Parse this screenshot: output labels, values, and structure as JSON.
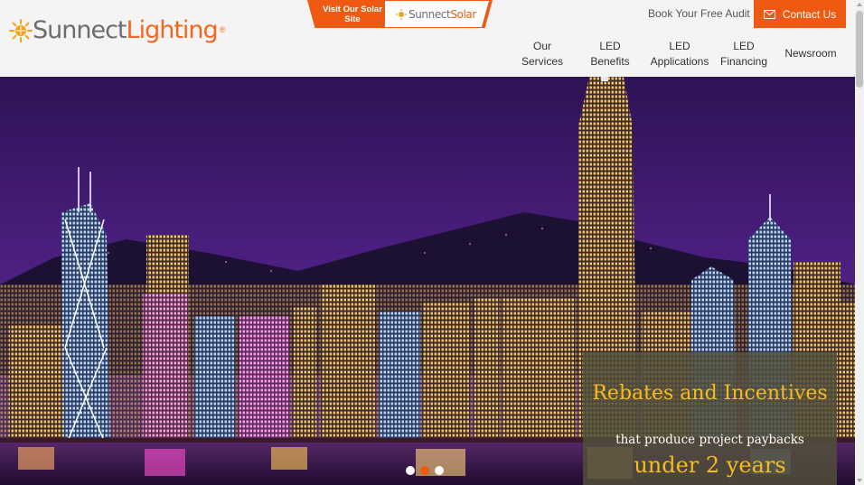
{
  "header": {
    "logo": {
      "part1": "Sunnect",
      "part2": "Lighting",
      "mark": "®"
    },
    "solar_link": {
      "label": "Visit Our Solar Site",
      "brand_part1": "Sunnect",
      "brand_part2": "Solar"
    },
    "book_audit": "Book Your Free Audit",
    "contact": {
      "label": "Contact Us",
      "icon": "envelope-icon"
    }
  },
  "nav": [
    {
      "line1": "Our",
      "line2": "Services"
    },
    {
      "line1": "LED",
      "line2": "Benefits"
    },
    {
      "line1": "LED",
      "line2": "Applications"
    },
    {
      "line1": "LED",
      "line2": "Financing"
    },
    {
      "line1": "Newsroom",
      "line2": ""
    }
  ],
  "hero": {
    "image": "Hong Kong city skyline at night",
    "promo": {
      "heading": "Rebates and Incentives",
      "subtext": "that produce project paybacks",
      "highlight": "under 2 years"
    },
    "slides": {
      "count": 3,
      "active": 2
    }
  },
  "colors": {
    "accent": "#ee5a11",
    "promo_text": "#f6bc1b",
    "logo_grey": "#6d6d6d"
  }
}
